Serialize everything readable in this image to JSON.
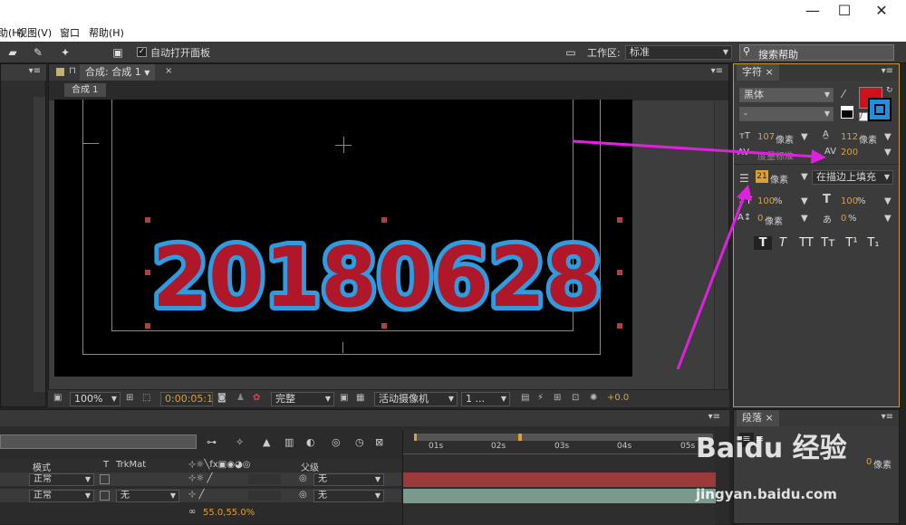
{
  "menu": {
    "items": [
      "帮助(H)",
      "视图(V)",
      "窗口",
      "帮助(H)"
    ],
    "view": "视图(V)",
    "window": "窗口",
    "help": "帮助(H)",
    "partial": "助(H)"
  },
  "toolbar": {
    "auto_open_panel": "自动打开面板",
    "workspace_label": "工作区:",
    "workspace_value": "标准",
    "search_placeholder": "搜索帮助"
  },
  "composition": {
    "tab_label": "合成: 合成 1",
    "breadcrumb": "合成 1",
    "digits": "20180628",
    "zoom": "100%",
    "timecode": "0:00:05:18",
    "resolution": "完整",
    "camera": "活动摄像机",
    "views": "1 ...",
    "exposure": "+0.0"
  },
  "character": {
    "tab_label": "字符",
    "font_family": "黑体",
    "font_style": "-",
    "font_size": "107",
    "font_size_unit": "像素",
    "leading": "112",
    "leading_unit": "像素",
    "kerning_label": "度量标准",
    "tracking": "200",
    "stroke_width": "21",
    "stroke_unit": "像素",
    "stroke_mode": "在描边上填充",
    "vertical_scale": "100",
    "horizontal_scale": "100",
    "percent": "%",
    "baseline_shift": "0",
    "baseline_unit": "像素",
    "tsume": "0",
    "fill_color": "#d0101a",
    "stroke_color": "#1e90e0",
    "style_buttons": [
      "T",
      "T",
      "TT",
      "Tт",
      "T¹",
      "T₁"
    ]
  },
  "paragraph": {
    "tab_label": "段落",
    "indent_value": "0",
    "indent_unit": "像素"
  },
  "timeline": {
    "mode_header": "模式",
    "t_header": "T",
    "trkmat_header": "TrkMat",
    "parent_header": "父级",
    "rows": [
      {
        "mode": "正常",
        "trkmat": "",
        "parent": "无"
      },
      {
        "mode": "正常",
        "trkmat": "无",
        "parent": "无"
      }
    ],
    "scale_value": "55.0,55.0%",
    "ruler": [
      "01s",
      "02s",
      "03s",
      "04s",
      "05s"
    ]
  },
  "watermark": {
    "brand": "Baidu 经验",
    "url": "jingyan.baidu.com"
  },
  "colors": {
    "digit_fill": "#b0182a",
    "digit_stroke": "#2f9be0",
    "arrow": "#e020e0",
    "accent": "#e0a030"
  }
}
